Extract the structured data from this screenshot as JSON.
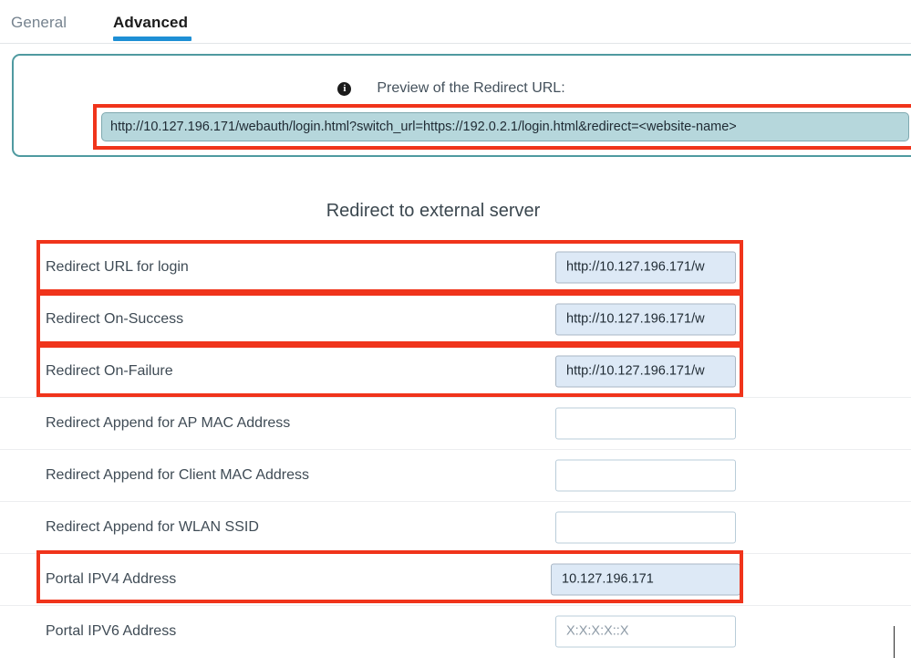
{
  "tabs": [
    {
      "label": "General",
      "active": false
    },
    {
      "label": "Advanced",
      "active": true
    }
  ],
  "preview": {
    "info_icon": "info-icon",
    "heading": "Preview of the Redirect URL:",
    "url": "http://10.127.196.171/webauth/login.html?switch_url=https://192.0.2.1/login.html&redirect=<website-name>"
  },
  "section": {
    "title": "Redirect to external server"
  },
  "fields": [
    {
      "label": "Redirect URL for login",
      "value": "http://10.127.196.171/w",
      "placeholder": "",
      "state": "filled",
      "highlighted": true
    },
    {
      "label": "Redirect On-Success",
      "value": "http://10.127.196.171/w",
      "placeholder": "",
      "state": "filled",
      "highlighted": true
    },
    {
      "label": "Redirect On-Failure",
      "value": "http://10.127.196.171/w",
      "placeholder": "",
      "state": "filled",
      "highlighted": true
    },
    {
      "label": "Redirect Append for AP MAC Address",
      "value": "",
      "placeholder": "",
      "state": "empty",
      "highlighted": false
    },
    {
      "label": "Redirect Append for Client MAC Address",
      "value": "",
      "placeholder": "",
      "state": "empty",
      "highlighted": false
    },
    {
      "label": "Redirect Append for WLAN SSID",
      "value": "",
      "placeholder": "",
      "state": "empty",
      "highlighted": false
    },
    {
      "label": "Portal IPV4 Address",
      "value": "10.127.196.171",
      "placeholder": "",
      "state": "filled",
      "highlighted": true
    },
    {
      "label": "Portal IPV6 Address",
      "value": "",
      "placeholder": "X:X:X:X::X",
      "state": "empty",
      "highlighted": false
    }
  ],
  "colors": {
    "accent_blue": "#1e8fd5",
    "highlight_red": "#f0341b",
    "panel_teal": "#4f9aa0",
    "preview_fill": "#b6d7dc",
    "field_fill": "#dde9f6"
  }
}
